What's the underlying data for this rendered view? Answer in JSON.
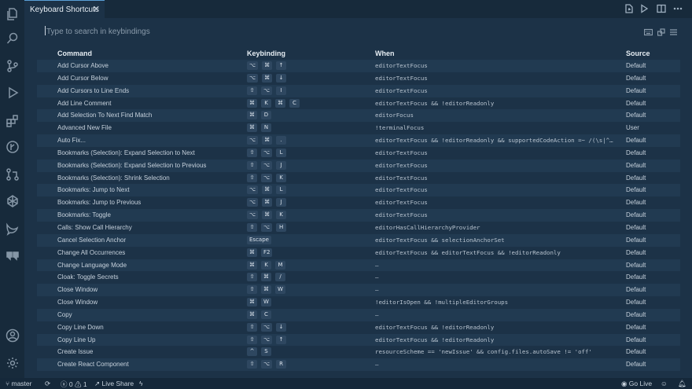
{
  "tab": {
    "title": "Keyboard Shortcuts",
    "close": "✕"
  },
  "search": {
    "placeholder": "Type to search in keybindings"
  },
  "headers": {
    "command": "Command",
    "keybinding": "Keybinding",
    "when": "When",
    "source": "Source"
  },
  "rows": [
    {
      "command": "Add Cursor Above",
      "keys": [
        "⌥",
        "⌘",
        "↑"
      ],
      "when": "editorTextFocus",
      "source": "Default"
    },
    {
      "command": "Add Cursor Below",
      "keys": [
        "⌥",
        "⌘",
        "↓"
      ],
      "when": "editorTextFocus",
      "source": "Default"
    },
    {
      "command": "Add Cursors to Line Ends",
      "keys": [
        "⇧",
        "⌥",
        "I"
      ],
      "when": "editorTextFocus",
      "source": "Default"
    },
    {
      "command": "Add Line Comment",
      "keys": [
        "⌘",
        "K",
        "⌘",
        "C"
      ],
      "when": "editorTextFocus && !editorReadonly",
      "source": "Default"
    },
    {
      "command": "Add Selection To Next Find Match",
      "keys": [
        "⌘",
        "D"
      ],
      "when": "editorFocus",
      "source": "Default"
    },
    {
      "command": "Advanced New File",
      "keys": [
        "⌘",
        "N"
      ],
      "when": "!terminalFocus",
      "source": "User"
    },
    {
      "command": "Auto Fix...",
      "keys": [
        "⌥",
        "⌘",
        "."
      ],
      "when": "editorTextFocus && !editorReadonly && supportedCodeAction =~ /(\\s|^…",
      "source": "Default"
    },
    {
      "command": "Bookmarks (Selection): Expand Selection to Next",
      "keys": [
        "⇧",
        "⌥",
        "L"
      ],
      "when": "editorTextFocus",
      "source": "Default"
    },
    {
      "command": "Bookmarks (Selection): Expand Selection to Previous",
      "keys": [
        "⇧",
        "⌥",
        "J"
      ],
      "when": "editorTextFocus",
      "source": "Default"
    },
    {
      "command": "Bookmarks (Selection): Shrink Selection",
      "keys": [
        "⇧",
        "⌥",
        "K"
      ],
      "when": "editorTextFocus",
      "source": "Default"
    },
    {
      "command": "Bookmarks: Jump to Next",
      "keys": [
        "⌥",
        "⌘",
        "L"
      ],
      "when": "editorTextFocus",
      "source": "Default"
    },
    {
      "command": "Bookmarks: Jump to Previous",
      "keys": [
        "⌥",
        "⌘",
        "J"
      ],
      "when": "editorTextFocus",
      "source": "Default"
    },
    {
      "command": "Bookmarks: Toggle",
      "keys": [
        "⌥",
        "⌘",
        "K"
      ],
      "when": "editorTextFocus",
      "source": "Default"
    },
    {
      "command": "Calls: Show Call Hierarchy",
      "keys": [
        "⇧",
        "⌥",
        "H"
      ],
      "when": "editorHasCallHierarchyProvider",
      "source": "Default"
    },
    {
      "command": "Cancel Selection Anchor",
      "keys": [
        "Escape"
      ],
      "when": "editorTextFocus && selectionAnchorSet",
      "source": "Default"
    },
    {
      "command": "Change All Occurrences",
      "keys": [
        "⌘",
        "F2"
      ],
      "when": "editorTextFocus && editorTextFocus && !editorReadonly",
      "source": "Default"
    },
    {
      "command": "Change Language Mode",
      "keys": [
        "⌘",
        "K",
        "M"
      ],
      "when": "—",
      "source": "Default"
    },
    {
      "command": "Cloak: Toggle Secrets",
      "keys": [
        "⇧",
        "⌘",
        "/"
      ],
      "when": "—",
      "source": "Default"
    },
    {
      "command": "Close Window",
      "keys": [
        "⇧",
        "⌘",
        "W"
      ],
      "when": "—",
      "source": "Default"
    },
    {
      "command": "Close Window",
      "keys": [
        "⌘",
        "W"
      ],
      "when": "!editorIsOpen && !multipleEditorGroups",
      "source": "Default"
    },
    {
      "command": "Copy",
      "keys": [
        "⌘",
        "C"
      ],
      "when": "—",
      "source": "Default"
    },
    {
      "command": "Copy Line Down",
      "keys": [
        "⇧",
        "⌥",
        "↓"
      ],
      "when": "editorTextFocus && !editorReadonly",
      "source": "Default"
    },
    {
      "command": "Copy Line Up",
      "keys": [
        "⇧",
        "⌥",
        "↑"
      ],
      "when": "editorTextFocus && !editorReadonly",
      "source": "Default"
    },
    {
      "command": "Create Issue",
      "keys": [
        "^",
        "S"
      ],
      "when": "resourceScheme == 'newIssue' && config.files.autoSave != 'off'",
      "source": "Default"
    },
    {
      "command": "Create React Component",
      "keys": [
        "⇧",
        "⌥",
        "R"
      ],
      "when": "—",
      "source": "Default"
    }
  ],
  "status": {
    "branch": "master",
    "errors": "0",
    "warnings": "1",
    "live_share": "Live Share",
    "go_live": "Go Live"
  },
  "colors": {
    "background": "#1c3247",
    "activity_bar": "#172a3b",
    "accent": "#5aa0d6"
  }
}
